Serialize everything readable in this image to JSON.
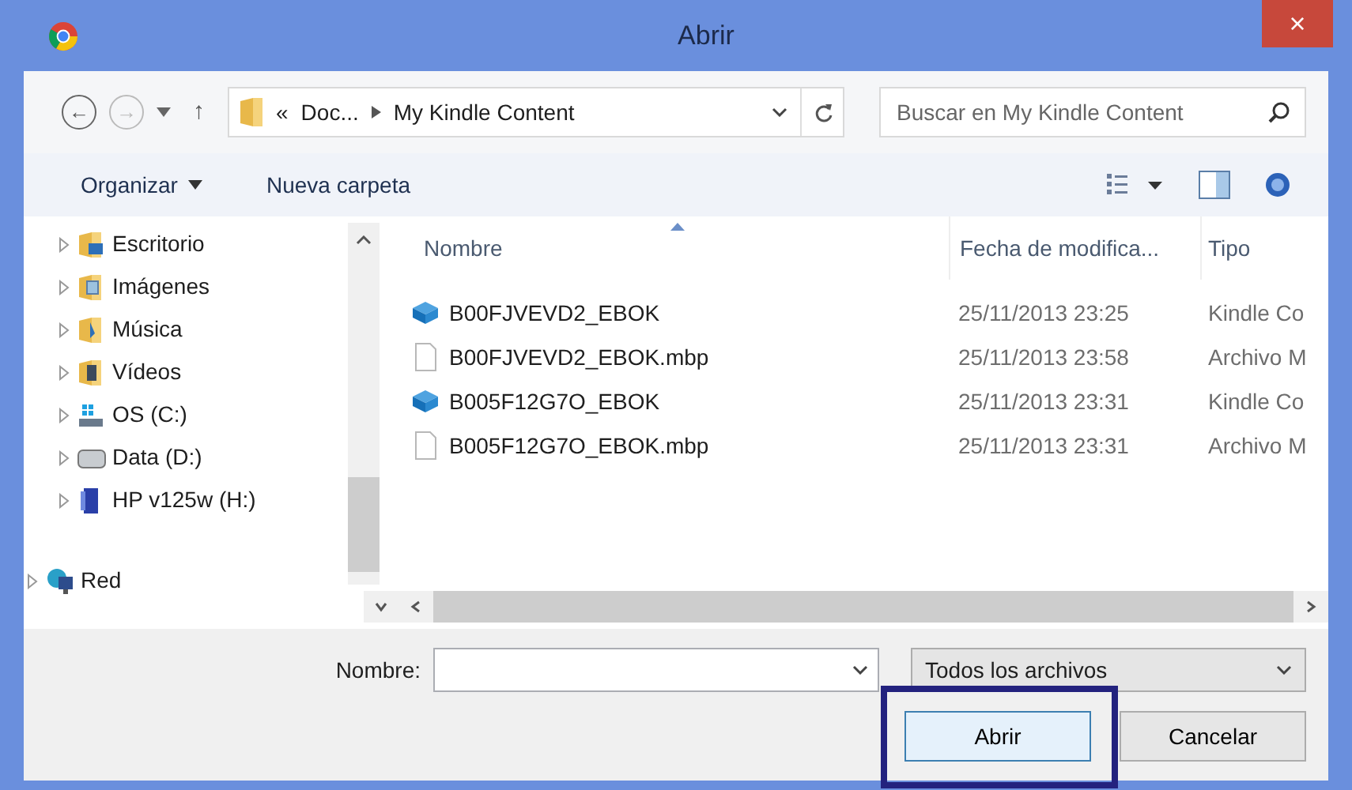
{
  "window": {
    "title": "Abrir",
    "close": "×"
  },
  "address": {
    "back": "←",
    "forward": "→",
    "up": "↑",
    "overflow": "«",
    "crumbs": [
      "Doc...",
      "My Kindle Content"
    ],
    "search_placeholder": "Buscar en My Kindle Content"
  },
  "toolbar": {
    "organize": "Organizar",
    "new_folder": "Nueva carpeta"
  },
  "sidebar": {
    "items": [
      {
        "label": "Escritorio",
        "kind": "desktop"
      },
      {
        "label": "Imágenes",
        "kind": "pictures"
      },
      {
        "label": "Música",
        "kind": "music"
      },
      {
        "label": "Vídeos",
        "kind": "videos"
      },
      {
        "label": "OS (C:)",
        "kind": "system-drive"
      },
      {
        "label": "Data (D:)",
        "kind": "drive"
      },
      {
        "label": "HP v125w (H:)",
        "kind": "usb"
      }
    ],
    "network": {
      "label": "Red",
      "kind": "network"
    }
  },
  "table": {
    "columns": [
      "Nombre",
      "Fecha de modifica...",
      "Tipo"
    ],
    "rows": [
      {
        "name": "B00FJVEVD2_EBOK",
        "date": "25/11/2013 23:25",
        "type": "Kindle Co",
        "kind": "kindle"
      },
      {
        "name": "B00FJVEVD2_EBOK.mbp",
        "date": "25/11/2013 23:58",
        "type": "Archivo M",
        "kind": "file"
      },
      {
        "name": "B005F12G7O_EBOK",
        "date": "25/11/2013 23:31",
        "type": "Kindle Co",
        "kind": "kindle"
      },
      {
        "name": "B005F12G7O_EBOK.mbp",
        "date": "25/11/2013 23:31",
        "type": "Archivo M",
        "kind": "file"
      }
    ]
  },
  "footer": {
    "name_label": "Nombre:",
    "filter": "Todos los archivos",
    "buttons": [
      {
        "label": "Abrir",
        "highlighted": true
      },
      {
        "label": "Cancelar",
        "highlighted": false
      }
    ]
  }
}
